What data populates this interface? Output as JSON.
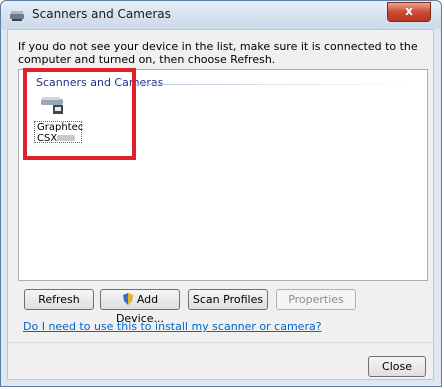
{
  "window": {
    "title": "Scanners and Cameras",
    "close_glyph": "x"
  },
  "intro_text": "If you do not see your device in the list, make sure it is connected to the computer and turned on, then choose Refresh.",
  "group": {
    "header": "Scanners and Cameras",
    "devices": [
      {
        "name_line1": "Graphtec",
        "name_line2": "CSX",
        "icon": "scanner-icon"
      }
    ]
  },
  "buttons": {
    "refresh": "Refresh",
    "add_device": "Add Device...",
    "scan_profiles": "Scan Profiles",
    "properties": "Properties",
    "close": "Close"
  },
  "help_link": "Do I need to use this to install my scanner or camera?",
  "colors": {
    "highlight": "#e0202a",
    "link": "#0066cc",
    "group_header": "#1e3287"
  }
}
